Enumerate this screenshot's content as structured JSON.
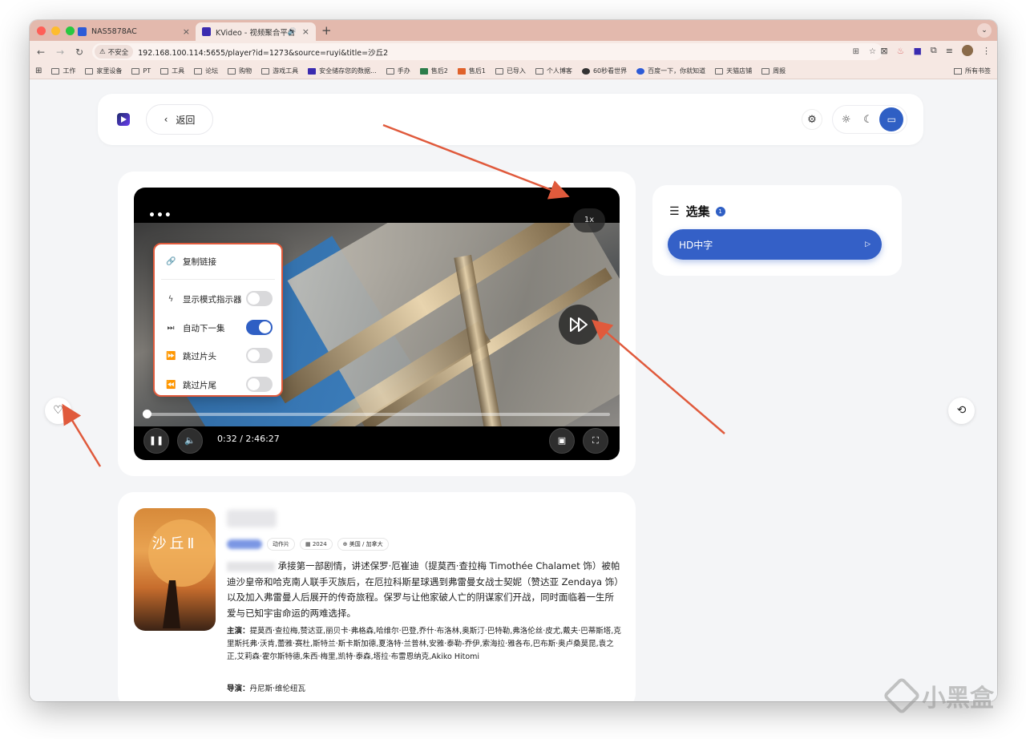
{
  "browser": {
    "tabs": [
      {
        "title": "NAS5878AC",
        "close": "×"
      },
      {
        "title": "KVideo - 视频聚合平台",
        "close": "×"
      }
    ],
    "new_tab": "+",
    "insecure_label": "不安全",
    "url": "192.168.100.114:5655/player?id=1273&source=ruyi&title=沙丘2",
    "bookmarks": [
      "工作",
      "家里设备",
      "PT",
      "工具",
      "论坛",
      "购物",
      "游戏工具",
      "安全储存您的数据...",
      "手办",
      "售后2",
      "售后1",
      "已导入",
      "个人博客",
      "60秒看世界",
      "百度一下，你就知道",
      "天猫店铺",
      "周报"
    ],
    "bookmarks_end": "所有书签"
  },
  "header": {
    "back_label": "返回"
  },
  "player": {
    "more": "•••",
    "speed": "1x",
    "time": "0:32 / 2:46:27",
    "progress_fraction": 0.003,
    "menu": {
      "copy_link": "复制链接",
      "items": [
        {
          "label": "显示模式指示器",
          "on": false
        },
        {
          "label": "自动下一集",
          "on": true
        },
        {
          "label": "跳过片头",
          "on": false
        },
        {
          "label": "跳过片尾",
          "on": false
        }
      ]
    }
  },
  "episodes": {
    "title": "选集",
    "count": "1",
    "items": [
      "HD中字"
    ]
  },
  "info": {
    "poster_title": "沙丘Ⅱ",
    "tags": [
      "动作片",
      "2024",
      "美国 / 加拿大"
    ],
    "description": "承接第一部剧情，讲述保罗·厄崔迪（提莫西·查拉梅 Timothée Chalamet 饰）被帕迪沙皇帝和哈克南人联手灭族后，在厄拉科斯星球遇到弗雷曼女战士契妮（赞达亚 Zendaya 饰）以及加入弗雷曼人后展开的传奇旅程。保罗与让他家破人亡的阴谋家们开战，同时面临着一生所爱与已知宇宙命运的两难选择。",
    "cast_label": "主演：",
    "cast": "提莫西·查拉梅,赞达亚,丽贝卡·弗格森,哈维尔·巴登,乔什·布洛林,奥斯汀·巴特勒,弗洛伦丝·皮尤,戴夫·巴蒂斯塔,克里斯托弗·沃肯,蕾雅·赛杜,斯特兰·斯卡斯加德,夏洛特·兰普林,安雅·泰勒-乔伊,索海拉·雅各布,巴布斯·奥卢桑莫昆,袁之正,艾莉森·霍尔斯特德,朱西·梅里,凯特·泰森,塔拉·布雷恩纳克,Akiko Hitomi",
    "director_label": "导演：",
    "director": "丹尼斯·维伦纽瓦"
  },
  "watermark": "小黑盒",
  "colors": {
    "accent": "#2f5fc4",
    "annotation_red": "#e05a3c",
    "tabstrip": "#e3b9ad"
  }
}
